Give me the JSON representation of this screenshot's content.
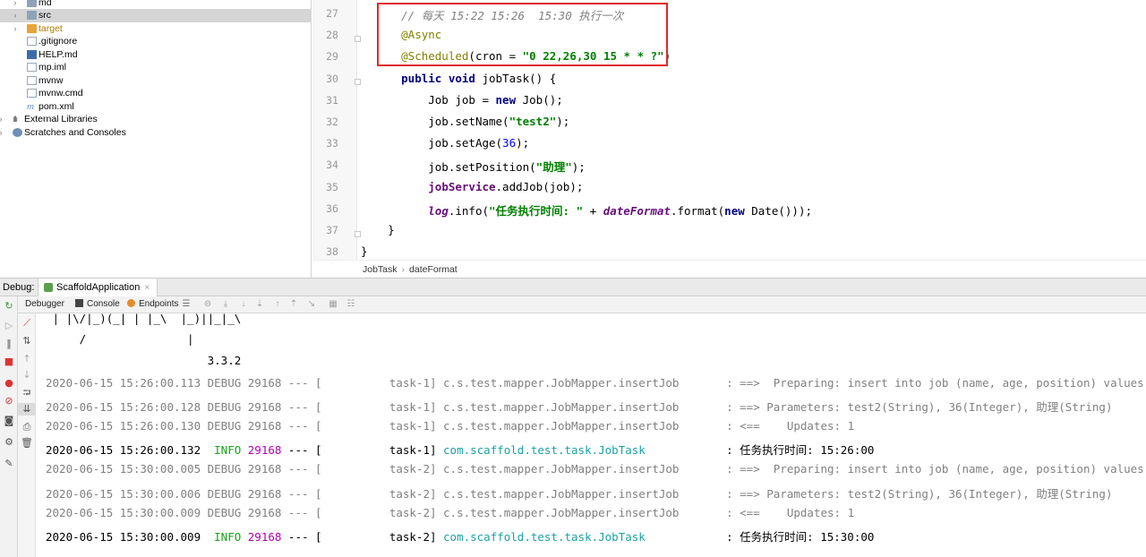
{
  "project_tree": {
    "items": [
      {
        "label": "md",
        "icon": "folder-icon"
      },
      {
        "label": "src",
        "icon": "folder-icon"
      },
      {
        "label": "target",
        "icon": "folder-icon"
      },
      {
        "label": ".gitignore",
        "icon": "file-icon"
      },
      {
        "label": "HELP.md",
        "icon": "markdown-icon"
      },
      {
        "label": "mp.iml",
        "icon": "file-icon"
      },
      {
        "label": "mvnw",
        "icon": "file-icon"
      },
      {
        "label": "mvnw.cmd",
        "icon": "file-icon"
      },
      {
        "label": "pom.xml",
        "icon": "maven-icon"
      },
      {
        "label": "External Libraries",
        "icon": "library-icon"
      },
      {
        "label": "Scratches and Consoles",
        "icon": "scratch-icon"
      }
    ],
    "selected": "src"
  },
  "editor": {
    "line_numbers": [
      "27",
      "28",
      "29",
      "30",
      "31",
      "32",
      "33",
      "34",
      "35",
      "36",
      "37",
      "38"
    ],
    "lines": [
      [
        {
          "t": "// 每天 15:22 15:26  15:30 执行一次",
          "c": "cmt"
        }
      ],
      [
        {
          "t": "@Async",
          "c": "ann"
        }
      ],
      [
        {
          "t": "@Scheduled",
          "c": "ann"
        },
        {
          "t": "(cron = ",
          "c": ""
        },
        {
          "t": "\"0 22,26,30 15 * * ?\"",
          "c": "str"
        },
        {
          "t": ")",
          "c": ""
        }
      ],
      [
        {
          "t": "public void ",
          "c": "kw"
        },
        {
          "t": "jobTask() {",
          "c": ""
        }
      ],
      [
        {
          "t": "    Job job = ",
          "c": ""
        },
        {
          "t": "new ",
          "c": "kw"
        },
        {
          "t": "Job();",
          "c": ""
        }
      ],
      [
        {
          "t": "    job.setName(",
          "c": ""
        },
        {
          "t": "\"test2\"",
          "c": "str"
        },
        {
          "t": ");",
          "c": ""
        }
      ],
      [
        {
          "t": "    job.setAge(",
          "c": ""
        },
        {
          "t": "36",
          "c": "num"
        },
        {
          "t": ");",
          "c": ""
        }
      ],
      [
        {
          "t": "    job.setPosition(",
          "c": ""
        },
        {
          "t": "\"助理\"",
          "c": "str"
        },
        {
          "t": ");",
          "c": ""
        }
      ],
      [
        {
          "t": "    ",
          "c": ""
        },
        {
          "t": "jobService",
          "c": "fld"
        },
        {
          "t": ".addJob(job);",
          "c": ""
        }
      ],
      [
        {
          "t": "    ",
          "c": ""
        },
        {
          "t": "log",
          "c": "fldi"
        },
        {
          "t": ".info(",
          "c": ""
        },
        {
          "t": "\"任务执行时间: \"",
          "c": "str"
        },
        {
          "t": " + ",
          "c": ""
        },
        {
          "t": "dateFormat",
          "c": "fldi"
        },
        {
          "t": ".format(",
          "c": ""
        },
        {
          "t": "new ",
          "c": "kw"
        },
        {
          "t": "Date()));",
          "c": ""
        }
      ],
      [
        {
          "t": "}",
          "c": ""
        }
      ],
      [
        {
          "t": "}",
          "c": ""
        }
      ]
    ]
  },
  "breadcrumbs": [
    "JobTask",
    "dateFormat"
  ],
  "debug": {
    "label": "Debug:",
    "tab": "ScaffoldApplication",
    "close_glyph": "×",
    "tabs": [
      "Debugger",
      "Console",
      "Endpoints"
    ]
  },
  "console": {
    "banner": [
      " | |\\/|_)(_| | |_\\  |_)||_|_\\",
      "     /               |",
      "                        3.3.2"
    ],
    "logs": [
      {
        "ts": "2020-06-15 15:26:00.113",
        "level": "DEBUG",
        "pid": "29168",
        "sep": " --- [",
        "thread": "          task-1]",
        "logger": " c.s.test.mapper.JobMapper.insertJob      ",
        "msg": " : ==>  Preparing: insert into job (name, age, position) values (?, ?, ?)",
        "info": false
      },
      {
        "ts": "2020-06-15 15:26:00.128",
        "level": "DEBUG",
        "pid": "29168",
        "sep": " --- [",
        "thread": "          task-1]",
        "logger": " c.s.test.mapper.JobMapper.insertJob      ",
        "msg": " : ==> Parameters: test2(String), 36(Integer), 助理(String)",
        "info": false
      },
      {
        "ts": "2020-06-15 15:26:00.130",
        "level": "DEBUG",
        "pid": "29168",
        "sep": " --- [",
        "thread": "          task-1]",
        "logger": " c.s.test.mapper.JobMapper.insertJob      ",
        "msg": " : <==    Updates: 1",
        "info": false
      },
      {
        "ts": "2020-06-15 15:26:00.132",
        "level": " INFO",
        "pid": "29168",
        "sep": " --- [",
        "thread": "          task-1]",
        "logger": " com.scaffold.test.task.JobTask           ",
        "msg": " : 任务执行时间: 15:26:00",
        "info": true
      },
      {
        "ts": "2020-06-15 15:30:00.005",
        "level": "DEBUG",
        "pid": "29168",
        "sep": " --- [",
        "thread": "          task-2]",
        "logger": " c.s.test.mapper.JobMapper.insertJob      ",
        "msg": " : ==>  Preparing: insert into job (name, age, position) values (?, ?, ?)",
        "info": false
      },
      {
        "ts": "2020-06-15 15:30:00.006",
        "level": "DEBUG",
        "pid": "29168",
        "sep": " --- [",
        "thread": "          task-2]",
        "logger": " c.s.test.mapper.JobMapper.insertJob      ",
        "msg": " : ==> Parameters: test2(String), 36(Integer), 助理(String)",
        "info": false
      },
      {
        "ts": "2020-06-15 15:30:00.009",
        "level": "DEBUG",
        "pid": "29168",
        "sep": " --- [",
        "thread": "          task-2]",
        "logger": " c.s.test.mapper.JobMapper.insertJob      ",
        "msg": " : <==    Updates: 1",
        "info": false
      },
      {
        "ts": "2020-06-15 15:30:00.009",
        "level": " INFO",
        "pid": "29168",
        "sep": " --- [",
        "thread": "          task-2]",
        "logger": " com.scaffold.test.task.JobTask           ",
        "msg": " : 任务执行时间: 15:30:00",
        "info": true
      }
    ]
  },
  "colors": {
    "highlight_box": "#e02828",
    "info_level": "#17a317",
    "logger_info": "#1ba1a5"
  }
}
